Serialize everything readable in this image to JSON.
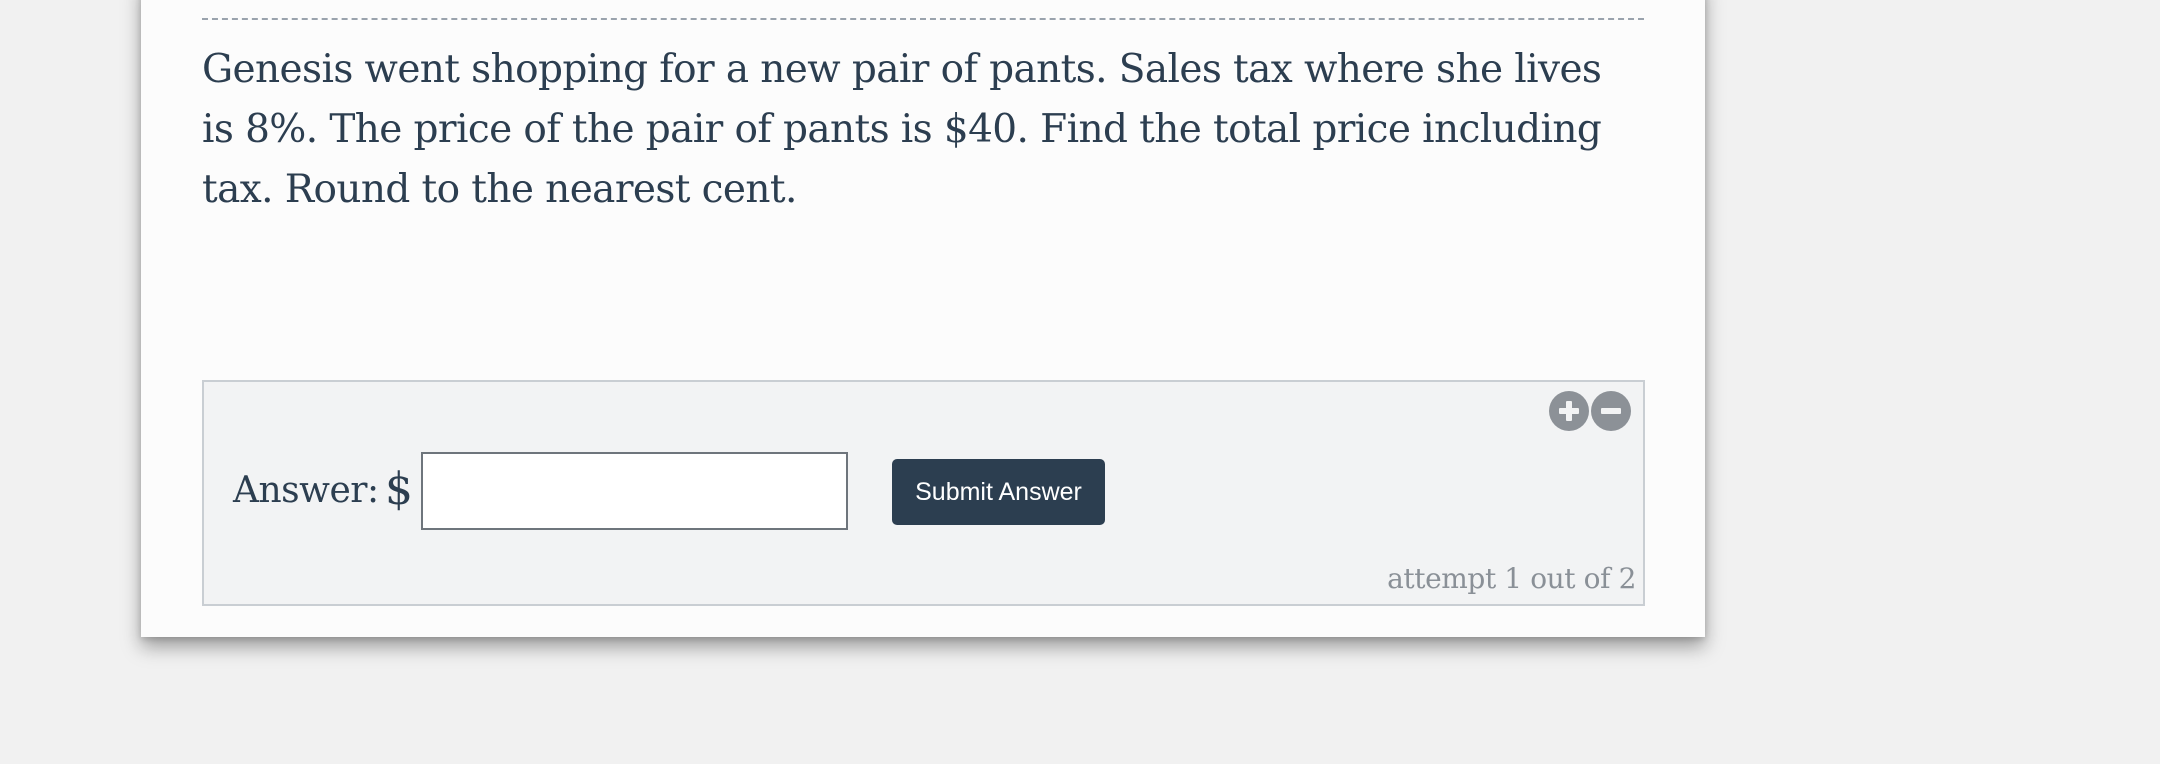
{
  "question": {
    "text": "Genesis went shopping for a new pair of pants. Sales tax where she lives is 8%. The price of the pair of pants is $40. Find the total price including tax. Round to the nearest cent."
  },
  "answer_panel": {
    "label": "Answer:",
    "currency_symbol": "$",
    "input_value": "",
    "input_placeholder": "",
    "submit_label": "Submit Answer",
    "attempt_text": "attempt 1 out of 2",
    "zoom_in_icon": "plus-circle",
    "zoom_out_icon": "minus-circle"
  },
  "colors": {
    "text": "#2c3e50",
    "button_bg": "#2c3e50",
    "panel_bg": "#f2f3f4",
    "icon": "#8c9197",
    "attempt_text": "#8a9097"
  }
}
